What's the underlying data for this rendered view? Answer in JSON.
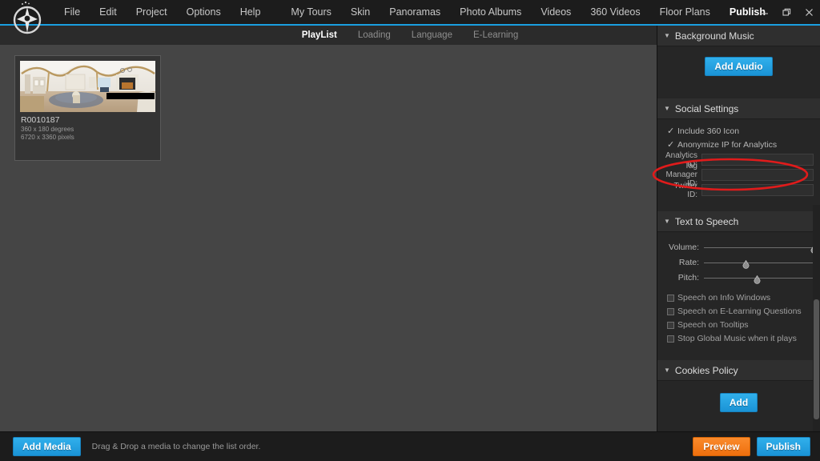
{
  "app": {
    "logo_icon": "pano-tour-logo-icon"
  },
  "menubar": {
    "items": [
      {
        "label": "File",
        "active": false
      },
      {
        "label": "Edit",
        "active": false
      },
      {
        "label": "Project",
        "active": false
      },
      {
        "label": "Options",
        "active": false
      },
      {
        "label": "Help",
        "active": false
      },
      {
        "label": "My Tours",
        "active": false
      },
      {
        "label": "Skin",
        "active": false
      },
      {
        "label": "Panoramas",
        "active": false
      },
      {
        "label": "Photo Albums",
        "active": false
      },
      {
        "label": "Videos",
        "active": false
      },
      {
        "label": "360 Videos",
        "active": false
      },
      {
        "label": "Floor Plans",
        "active": false
      },
      {
        "label": "Publish",
        "active": true
      }
    ],
    "window_controls": {
      "minimize": "minimize-icon",
      "restore": "restore-icon",
      "close": "close-icon"
    },
    "accent_color": "#1a9fe0"
  },
  "subtabs": {
    "items": [
      {
        "label": "PlayList",
        "active": true
      },
      {
        "label": "Loading",
        "active": false
      },
      {
        "label": "Language",
        "active": false
      },
      {
        "label": "E-Learning",
        "active": false
      }
    ]
  },
  "canvas": {
    "media": [
      {
        "title": "R0010187",
        "degrees": "360 x 180 degrees",
        "pixels": "6720 x 3360 pixels"
      }
    ]
  },
  "panel": {
    "background_music": {
      "title": "Background Music",
      "add_audio_label": "Add Audio"
    },
    "social_settings": {
      "title": "Social Settings",
      "checkboxes": [
        {
          "label": "Include 360 Icon",
          "checked": true
        },
        {
          "label": "Anonymize IP for Analytics",
          "checked": true
        }
      ],
      "fields": [
        {
          "label": "Analytics ID:",
          "value": "",
          "placeholder": ""
        },
        {
          "label": "Tag Manager ID:",
          "value": "",
          "placeholder": ""
        },
        {
          "label": "Twitter ID:",
          "value": "",
          "placeholder": ""
        }
      ]
    },
    "text_to_speech": {
      "title": "Text to Speech",
      "sliders": [
        {
          "label": "Volume:",
          "value": 100
        },
        {
          "label": "Rate:",
          "value": 38
        },
        {
          "label": "Pitch:",
          "value": 48
        }
      ],
      "checkboxes": [
        {
          "label": "Speech on Info Windows",
          "checked": false
        },
        {
          "label": "Speech on E-Learning Questions",
          "checked": false
        },
        {
          "label": "Speech on Tooltips",
          "checked": false
        },
        {
          "label": "Stop Global Music when it plays",
          "checked": false
        }
      ]
    },
    "cookies_policy": {
      "title": "Cookies Policy",
      "add_label": "Add"
    }
  },
  "bottombar": {
    "add_media_label": "Add Media",
    "hint": "Drag & Drop a media to change the list order.",
    "preview_label": "Preview",
    "publish_label": "Publish"
  },
  "annotation": {
    "shape": "ellipse",
    "color": "#e01b1b",
    "target": "Tag Manager ID field"
  }
}
